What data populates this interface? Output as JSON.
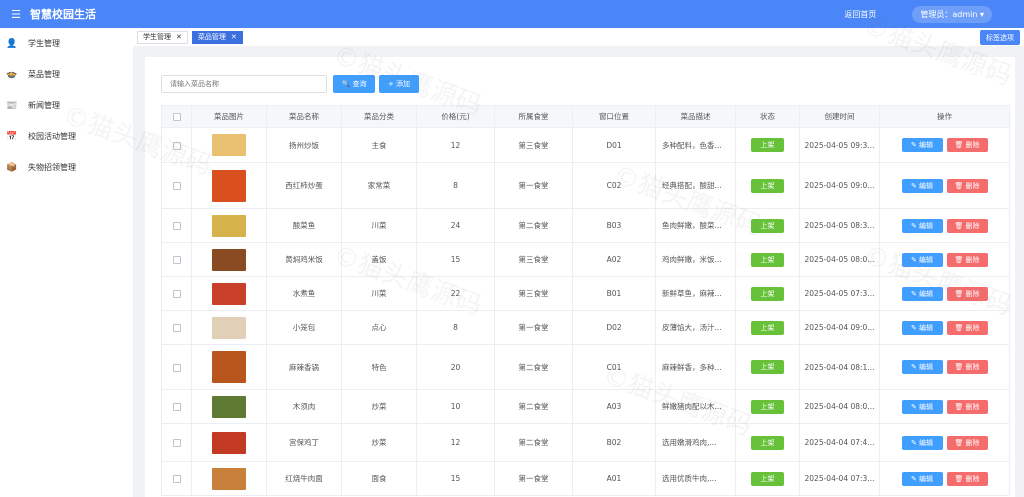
{
  "header": {
    "menu_icon": "menu-icon",
    "title": "智慧校园生活",
    "home_link": "返回首页",
    "admin": "管理员：admin ▾"
  },
  "sidebar": {
    "items": [
      {
        "icon": "👤",
        "label": "学生管理"
      },
      {
        "icon": "🍲",
        "label": "菜品管理"
      },
      {
        "icon": "📰",
        "label": "新闻管理"
      },
      {
        "icon": "📅",
        "label": "校园活动管理"
      },
      {
        "icon": "📦",
        "label": "失物招领管理"
      }
    ]
  },
  "tabs": {
    "items": [
      {
        "label": "学生管理"
      },
      {
        "label": "菜品管理"
      }
    ],
    "close": "✕",
    "options": "标签选项"
  },
  "toolbar": {
    "search_placeholder": "请输入菜品名称",
    "query_label": "🔍 查询",
    "add_label": "+ 添加"
  },
  "table": {
    "headers": [
      "菜品图片",
      "菜品名称",
      "菜品分类",
      "价格(元)",
      "所属食堂",
      "窗口位置",
      "菜品描述",
      "状态",
      "创建时间",
      "操作"
    ],
    "rows": [
      {
        "name": "扬州炒饭",
        "category": "主食",
        "price": "12",
        "canteen": "第三食堂",
        "window": "D01",
        "desc": "多种配料，色香...",
        "status": "上架",
        "created": "2025-04-05 09:3...",
        "img": "#e8c070",
        "h": 35
      },
      {
        "name": "西红柿炒蛋",
        "category": "家常菜",
        "price": "8",
        "canteen": "第一食堂",
        "window": "C02",
        "desc": "经典搭配，酸甜...",
        "status": "上架",
        "created": "2025-04-05 09:0...",
        "img": "#d9501e",
        "h": 46
      },
      {
        "name": "酸菜鱼",
        "category": "川菜",
        "price": "24",
        "canteen": "第二食堂",
        "window": "B03",
        "desc": "鱼肉鲜嫩，酸菜...",
        "status": "上架",
        "created": "2025-04-05 08:3...",
        "img": "#d6b24a",
        "h": 34
      },
      {
        "name": "黄焖鸡米饭",
        "category": "盖饭",
        "price": "15",
        "canteen": "第三食堂",
        "window": "A02",
        "desc": "鸡肉鲜嫩，米饭...",
        "status": "上架",
        "created": "2025-04-05 08:0...",
        "img": "#8a4a22",
        "h": 34
      },
      {
        "name": "水煮鱼",
        "category": "川菜",
        "price": "22",
        "canteen": "第三食堂",
        "window": "B01",
        "desc": "新鲜草鱼，麻辣...",
        "status": "上架",
        "created": "2025-04-05 07:3...",
        "img": "#c8402a",
        "h": 34
      },
      {
        "name": "小笼包",
        "category": "点心",
        "price": "8",
        "canteen": "第一食堂",
        "window": "D02",
        "desc": "皮薄馅大，汤汁...",
        "status": "上架",
        "created": "2025-04-04 09:0...",
        "img": "#e0d0b8",
        "h": 34
      },
      {
        "name": "麻辣香锅",
        "category": "特色",
        "price": "20",
        "canteen": "第二食堂",
        "window": "C01",
        "desc": "麻辣鲜香，多种...",
        "status": "上架",
        "created": "2025-04-04 08:1...",
        "img": "#b8561e",
        "h": 45
      },
      {
        "name": "木须肉",
        "category": "炒菜",
        "price": "10",
        "canteen": "第二食堂",
        "window": "A03",
        "desc": "鲜嫩猪肉配以木...",
        "status": "上架",
        "created": "2025-04-04 08:0...",
        "img": "#5e7a32",
        "h": 34
      },
      {
        "name": "宫保鸡丁",
        "category": "炒菜",
        "price": "12",
        "canteen": "第二食堂",
        "window": "B02",
        "desc": "选用嫩滑鸡肉,...",
        "status": "上架",
        "created": "2025-04-04 07:4...",
        "img": "#c23a24",
        "h": 38
      },
      {
        "name": "红烧牛肉面",
        "category": "面食",
        "price": "15",
        "canteen": "第一食堂",
        "window": "A01",
        "desc": "选用优质牛肉,...",
        "status": "上架",
        "created": "2025-04-04 07:3...",
        "img": "#c8803a",
        "h": 34
      }
    ],
    "edit_label": "✎ 编辑",
    "delete_label": "🗑 删除"
  },
  "colors": {
    "header": "#4a86f7",
    "primary": "#409eff",
    "success": "#67c23a",
    "danger": "#f56c6c",
    "active_tab": "#3c6fe0"
  }
}
